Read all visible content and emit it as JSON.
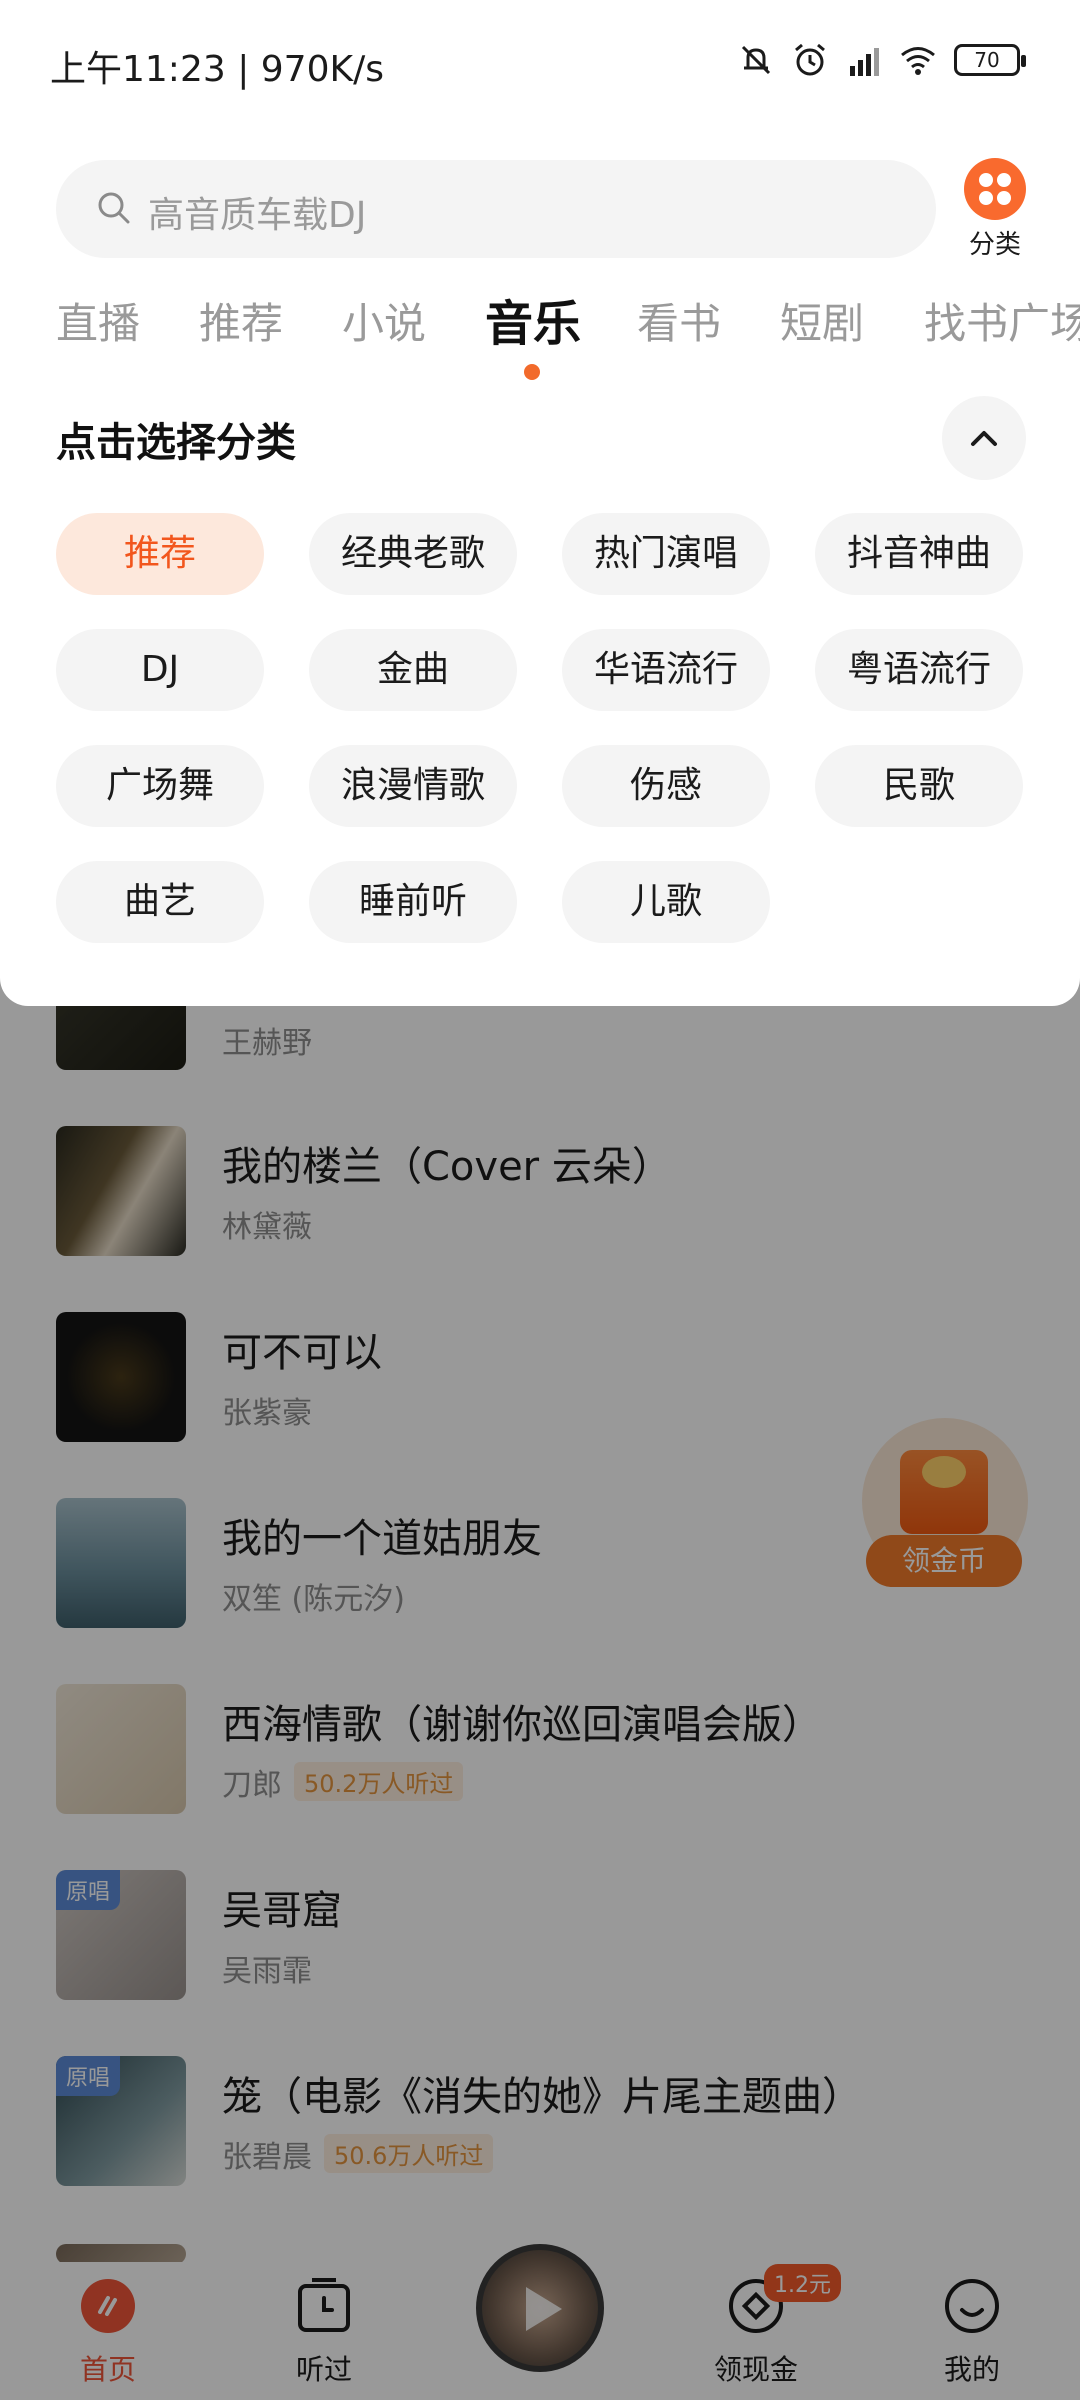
{
  "status_bar": {
    "left": "上午11:23 | 970K/s",
    "battery": "70"
  },
  "search": {
    "placeholder": "高音质车载DJ"
  },
  "category_button": {
    "label": "分类"
  },
  "tabs": [
    "直播",
    "推荐",
    "小说",
    "音乐",
    "看书",
    "短剧",
    "找书广场"
  ],
  "active_tab": "音乐",
  "category_panel": {
    "title": "点击选择分类",
    "chips": [
      "推荐",
      "经典老歌",
      "热门演唱",
      "抖音神曲",
      "DJ",
      "金曲",
      "华语流行",
      "粤语流行",
      "广场舞",
      "浪漫情歌",
      "伤感",
      "民歌",
      "曲艺",
      "睡前听",
      "儿歌"
    ],
    "selected": "推荐"
  },
  "songs": [
    {
      "title": "",
      "artist": "王赫野",
      "plays": "",
      "badge": ""
    },
    {
      "title": "我的楼兰（Cover 云朵）",
      "artist": "林黛薇",
      "plays": "",
      "badge": ""
    },
    {
      "title": "可不可以",
      "artist": "张紫豪",
      "plays": "",
      "badge": ""
    },
    {
      "title": "我的一个道姑朋友",
      "artist": "双笙 (陈元汐)",
      "plays": "",
      "badge": ""
    },
    {
      "title": "西海情歌（谢谢你巡回演唱会版）",
      "artist": "刀郎",
      "plays": "50.2万人听过",
      "badge": ""
    },
    {
      "title": "吴哥窟",
      "artist": "吴雨霏",
      "plays": "",
      "badge": "原唱"
    },
    {
      "title": "笼（电影《消失的她》片尾主题曲）",
      "artist": "张碧晨",
      "plays": "50.6万人听过",
      "badge": "原唱"
    }
  ],
  "coin_widget": {
    "label": "领金币"
  },
  "bottom_nav": {
    "items": [
      "首页",
      "听过",
      "领现金",
      "我的"
    ],
    "badge": "1.2元"
  },
  "colors": {
    "accent": "#f26a2b",
    "chip_active_bg": "#fde8dc",
    "chip_bg": "#f4f4f4"
  }
}
